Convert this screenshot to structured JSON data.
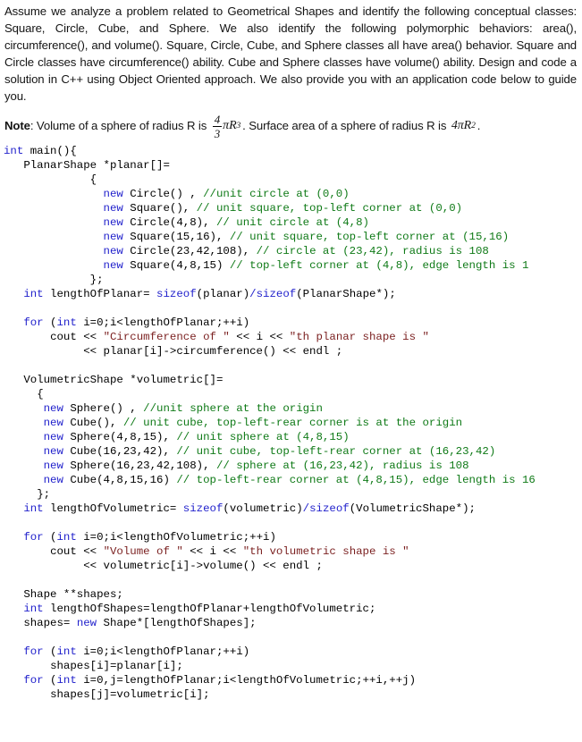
{
  "document": {
    "intro_paragraph": "Assume we analyze a problem related to Geometrical Shapes and identify the following conceptual classes: Square, Circle, Cube, and Sphere. We also identify the following polymorphic behaviors: area(), circumference(), and volume(). Square, Circle, Cube, and Sphere classes all have area() behavior. Square and Circle classes have circumference() ability. Cube and Sphere classes have volume() ability. Design and code a solution in C++ using Object Oriented approach. We also provide you with an application code below to guide you.",
    "note": {
      "label": "Note",
      "text_1": ": Volume of a sphere of radius R is",
      "formula_1": {
        "numerator": "4",
        "denominator": "3",
        "pi": "π",
        "base": "R",
        "exponent": "3"
      },
      "text_2": ". Surface area of a sphere of radius R is",
      "formula_2": {
        "coefficient": "4",
        "pi": "π",
        "base": "R",
        "exponent": "2"
      },
      "text_3": "."
    }
  },
  "colors": {
    "keyword": "#2222cc",
    "comment": "#0f7a17",
    "string": "#7a1f1f",
    "text": "#000000",
    "background": "#ffffff"
  },
  "code": {
    "language": "C++",
    "lines": [
      {
        "segments": [
          {
            "t": "kw",
            "v": "int"
          },
          {
            "t": "p",
            "v": " main(){"
          }
        ]
      },
      {
        "segments": [
          {
            "t": "p",
            "v": "   PlanarShape *planar[]="
          }
        ]
      },
      {
        "segments": [
          {
            "t": "p",
            "v": "             {"
          }
        ]
      },
      {
        "segments": [
          {
            "t": "p",
            "v": "               "
          },
          {
            "t": "kw",
            "v": "new"
          },
          {
            "t": "p",
            "v": " Circle() , "
          },
          {
            "t": "cm",
            "v": "//unit circle at (0,0)"
          }
        ]
      },
      {
        "segments": [
          {
            "t": "p",
            "v": "               "
          },
          {
            "t": "kw",
            "v": "new"
          },
          {
            "t": "p",
            "v": " Square(), "
          },
          {
            "t": "cm",
            "v": "// unit square, top-left corner at (0,0)"
          }
        ]
      },
      {
        "segments": [
          {
            "t": "p",
            "v": "               "
          },
          {
            "t": "kw",
            "v": "new"
          },
          {
            "t": "p",
            "v": " Circle(4,8), "
          },
          {
            "t": "cm",
            "v": "// unit circle at (4,8)"
          }
        ]
      },
      {
        "segments": [
          {
            "t": "p",
            "v": "               "
          },
          {
            "t": "kw",
            "v": "new"
          },
          {
            "t": "p",
            "v": " Square(15,16), "
          },
          {
            "t": "cm",
            "v": "// unit square, top-left corner at (15,16)"
          }
        ]
      },
      {
        "segments": [
          {
            "t": "p",
            "v": "               "
          },
          {
            "t": "kw",
            "v": "new"
          },
          {
            "t": "p",
            "v": " Circle(23,42,108), "
          },
          {
            "t": "cm",
            "v": "// circle at (23,42), radius is 108"
          }
        ]
      },
      {
        "segments": [
          {
            "t": "p",
            "v": "               "
          },
          {
            "t": "kw",
            "v": "new"
          },
          {
            "t": "p",
            "v": " Square(4,8,15) "
          },
          {
            "t": "cm",
            "v": "// top-left corner at (4,8), edge length is 1"
          }
        ]
      },
      {
        "segments": [
          {
            "t": "p",
            "v": "             };"
          }
        ]
      },
      {
        "segments": [
          {
            "t": "p",
            "v": "   "
          },
          {
            "t": "kw",
            "v": "int"
          },
          {
            "t": "p",
            "v": " lengthOfPlanar= "
          },
          {
            "t": "kw",
            "v": "sizeof"
          },
          {
            "t": "p",
            "v": "(planar)"
          },
          {
            "t": "op",
            "v": "/"
          },
          {
            "t": "kw",
            "v": "sizeof"
          },
          {
            "t": "p",
            "v": "(PlanarShape*);"
          }
        ]
      },
      {
        "blank": true
      },
      {
        "segments": [
          {
            "t": "p",
            "v": "   "
          },
          {
            "t": "kw",
            "v": "for"
          },
          {
            "t": "p",
            "v": " ("
          },
          {
            "t": "kw",
            "v": "int"
          },
          {
            "t": "p",
            "v": " i=0;i<lengthOfPlanar;++i)"
          }
        ]
      },
      {
        "segments": [
          {
            "t": "p",
            "v": "       cout << "
          },
          {
            "t": "str",
            "v": "\"Circumference of \""
          },
          {
            "t": "p",
            "v": " << i << "
          },
          {
            "t": "str",
            "v": "\"th planar shape is \""
          }
        ]
      },
      {
        "segments": [
          {
            "t": "p",
            "v": "            << planar[i]->circumference() << endl ;"
          }
        ]
      },
      {
        "blank": true
      },
      {
        "segments": [
          {
            "t": "p",
            "v": "   VolumetricShape *volumetric[]="
          }
        ]
      },
      {
        "segments": [
          {
            "t": "p",
            "v": "     {"
          }
        ]
      },
      {
        "segments": [
          {
            "t": "p",
            "v": "      "
          },
          {
            "t": "kw",
            "v": "new"
          },
          {
            "t": "p",
            "v": " Sphere() , "
          },
          {
            "t": "cm",
            "v": "//unit sphere at the origin"
          }
        ]
      },
      {
        "segments": [
          {
            "t": "p",
            "v": "      "
          },
          {
            "t": "kw",
            "v": "new"
          },
          {
            "t": "p",
            "v": " Cube(), "
          },
          {
            "t": "cm",
            "v": "// unit cube, top-left-rear corner is at the origin"
          }
        ]
      },
      {
        "segments": [
          {
            "t": "p",
            "v": "      "
          },
          {
            "t": "kw",
            "v": "new"
          },
          {
            "t": "p",
            "v": " Sphere(4,8,15), "
          },
          {
            "t": "cm",
            "v": "// unit sphere at (4,8,15)"
          }
        ]
      },
      {
        "segments": [
          {
            "t": "p",
            "v": "      "
          },
          {
            "t": "kw",
            "v": "new"
          },
          {
            "t": "p",
            "v": " Cube(16,23,42), "
          },
          {
            "t": "cm",
            "v": "// unit cube, top-left-rear corner at (16,23,42)"
          }
        ]
      },
      {
        "segments": [
          {
            "t": "p",
            "v": "      "
          },
          {
            "t": "kw",
            "v": "new"
          },
          {
            "t": "p",
            "v": " Sphere(16,23,42,108), "
          },
          {
            "t": "cm",
            "v": "// sphere at (16,23,42), radius is 108"
          }
        ]
      },
      {
        "segments": [
          {
            "t": "p",
            "v": "      "
          },
          {
            "t": "kw",
            "v": "new"
          },
          {
            "t": "p",
            "v": " Cube(4,8,15,16) "
          },
          {
            "t": "cm",
            "v": "// top-left-rear corner at (4,8,15), edge length is 16"
          }
        ]
      },
      {
        "segments": [
          {
            "t": "p",
            "v": "     };"
          }
        ]
      },
      {
        "segments": [
          {
            "t": "p",
            "v": "   "
          },
          {
            "t": "kw",
            "v": "int"
          },
          {
            "t": "p",
            "v": " lengthOfVolumetric= "
          },
          {
            "t": "kw",
            "v": "sizeof"
          },
          {
            "t": "p",
            "v": "(volumetric)"
          },
          {
            "t": "op",
            "v": "/"
          },
          {
            "t": "kw",
            "v": "sizeof"
          },
          {
            "t": "p",
            "v": "(VolumetricShape*);"
          }
        ]
      },
      {
        "blank": true
      },
      {
        "segments": [
          {
            "t": "p",
            "v": "   "
          },
          {
            "t": "kw",
            "v": "for"
          },
          {
            "t": "p",
            "v": " ("
          },
          {
            "t": "kw",
            "v": "int"
          },
          {
            "t": "p",
            "v": " i=0;i<lengthOfVolumetric;++i)"
          }
        ]
      },
      {
        "segments": [
          {
            "t": "p",
            "v": "       cout << "
          },
          {
            "t": "str",
            "v": "\"Volume of \""
          },
          {
            "t": "p",
            "v": " << i << "
          },
          {
            "t": "str",
            "v": "\"th volumetric shape is \""
          }
        ]
      },
      {
        "segments": [
          {
            "t": "p",
            "v": "            << volumetric[i]->volume() << endl ;"
          }
        ]
      },
      {
        "blank": true
      },
      {
        "segments": [
          {
            "t": "p",
            "v": "   Shape **shapes;"
          }
        ]
      },
      {
        "segments": [
          {
            "t": "p",
            "v": "   "
          },
          {
            "t": "kw",
            "v": "int"
          },
          {
            "t": "p",
            "v": " lengthOfShapes=lengthOfPlanar+lengthOfVolumetric;"
          }
        ]
      },
      {
        "segments": [
          {
            "t": "p",
            "v": "   shapes= "
          },
          {
            "t": "kw",
            "v": "new"
          },
          {
            "t": "p",
            "v": " Shape*[lengthOfShapes];"
          }
        ]
      },
      {
        "blank": true
      },
      {
        "segments": [
          {
            "t": "p",
            "v": "   "
          },
          {
            "t": "kw",
            "v": "for"
          },
          {
            "t": "p",
            "v": " ("
          },
          {
            "t": "kw",
            "v": "int"
          },
          {
            "t": "p",
            "v": " i=0;i<lengthOfPlanar;++i)"
          }
        ]
      },
      {
        "segments": [
          {
            "t": "p",
            "v": "       shapes[i]=planar[i];"
          }
        ]
      },
      {
        "segments": [
          {
            "t": "p",
            "v": "   "
          },
          {
            "t": "kw",
            "v": "for"
          },
          {
            "t": "p",
            "v": " ("
          },
          {
            "t": "kw",
            "v": "int"
          },
          {
            "t": "p",
            "v": " i=0,j=lengthOfPlanar;i<lengthOfVolumetric;++i,++j)"
          }
        ]
      },
      {
        "segments": [
          {
            "t": "p",
            "v": "       shapes[j]=volumetric[i];"
          }
        ]
      }
    ]
  }
}
